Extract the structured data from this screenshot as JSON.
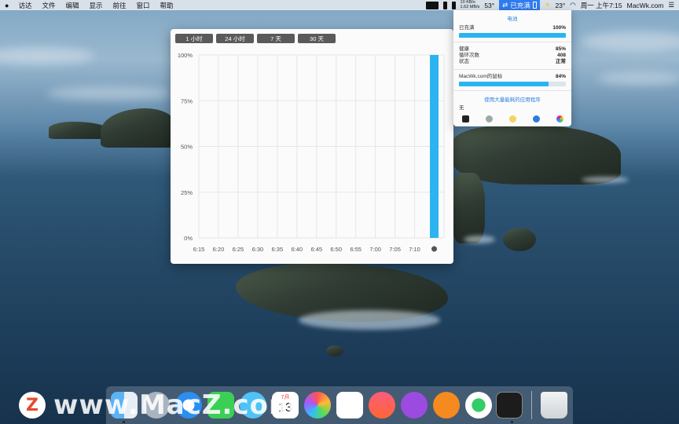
{
  "menubar": {
    "apple": "",
    "items": [
      "访达",
      "文件",
      "编辑",
      "显示",
      "前往",
      "窗口",
      "帮助"
    ],
    "net_up": "10 KB/s",
    "net_down": "1.62 MB/s",
    "temp1": "53°",
    "battery_status": "已充满",
    "temp2": "23°",
    "clock": "周一 上午7:15",
    "site": "MacWk.com"
  },
  "chart_window": {
    "tabs": [
      "1 小时",
      "24 小时",
      "7 天",
      "30 天"
    ],
    "active_tab": 0
  },
  "chart_data": {
    "type": "bar",
    "x": [
      "6:15",
      "6:20",
      "6:25",
      "6:30",
      "6:35",
      "6:40",
      "6:45",
      "6:50",
      "6:55",
      "7:00",
      "7:05",
      "7:10"
    ],
    "y_ticks": [
      "100%",
      "75%",
      "50%",
      "25%",
      "0%"
    ],
    "ylim": [
      0,
      100
    ],
    "bars": [
      {
        "x": "7:15",
        "value": 100
      }
    ],
    "bar_color": "#2bb4ef",
    "grid": true
  },
  "battery_panel": {
    "title": "电池",
    "charged_label": "已充满",
    "charged_value": "100%",
    "charged_fraction": 1.0,
    "health_label": "健康",
    "health_value": "85%",
    "cycles_label": "循环次数",
    "cycles_value": "408",
    "status_label": "状态",
    "status_value": "正常",
    "mouse_label": "MacWk.com的鼠标",
    "mouse_value": "84%",
    "mouse_fraction": 0.84,
    "apps_link": "使用大量能耗的应用程序",
    "apps_value": "无",
    "icons": [
      "terminal-icon",
      "robot-icon",
      "bulb-icon",
      "bluetooth-icon",
      "color-wheel-icon"
    ]
  },
  "dock": {
    "icons": [
      "finder-icon",
      "launchpad-icon",
      "safari-icon",
      "facetime-icon",
      "messages-icon",
      "calendar-icon",
      "photos-icon",
      "reminders-icon",
      "music-icon",
      "podcasts-icon",
      "books-icon",
      "find-my-icon",
      "terminal-icon",
      "trash-icon"
    ],
    "calendar_month": "7月",
    "calendar_day": "13"
  },
  "watermark": {
    "logo": "Z",
    "text": "www.MacZ.com"
  }
}
